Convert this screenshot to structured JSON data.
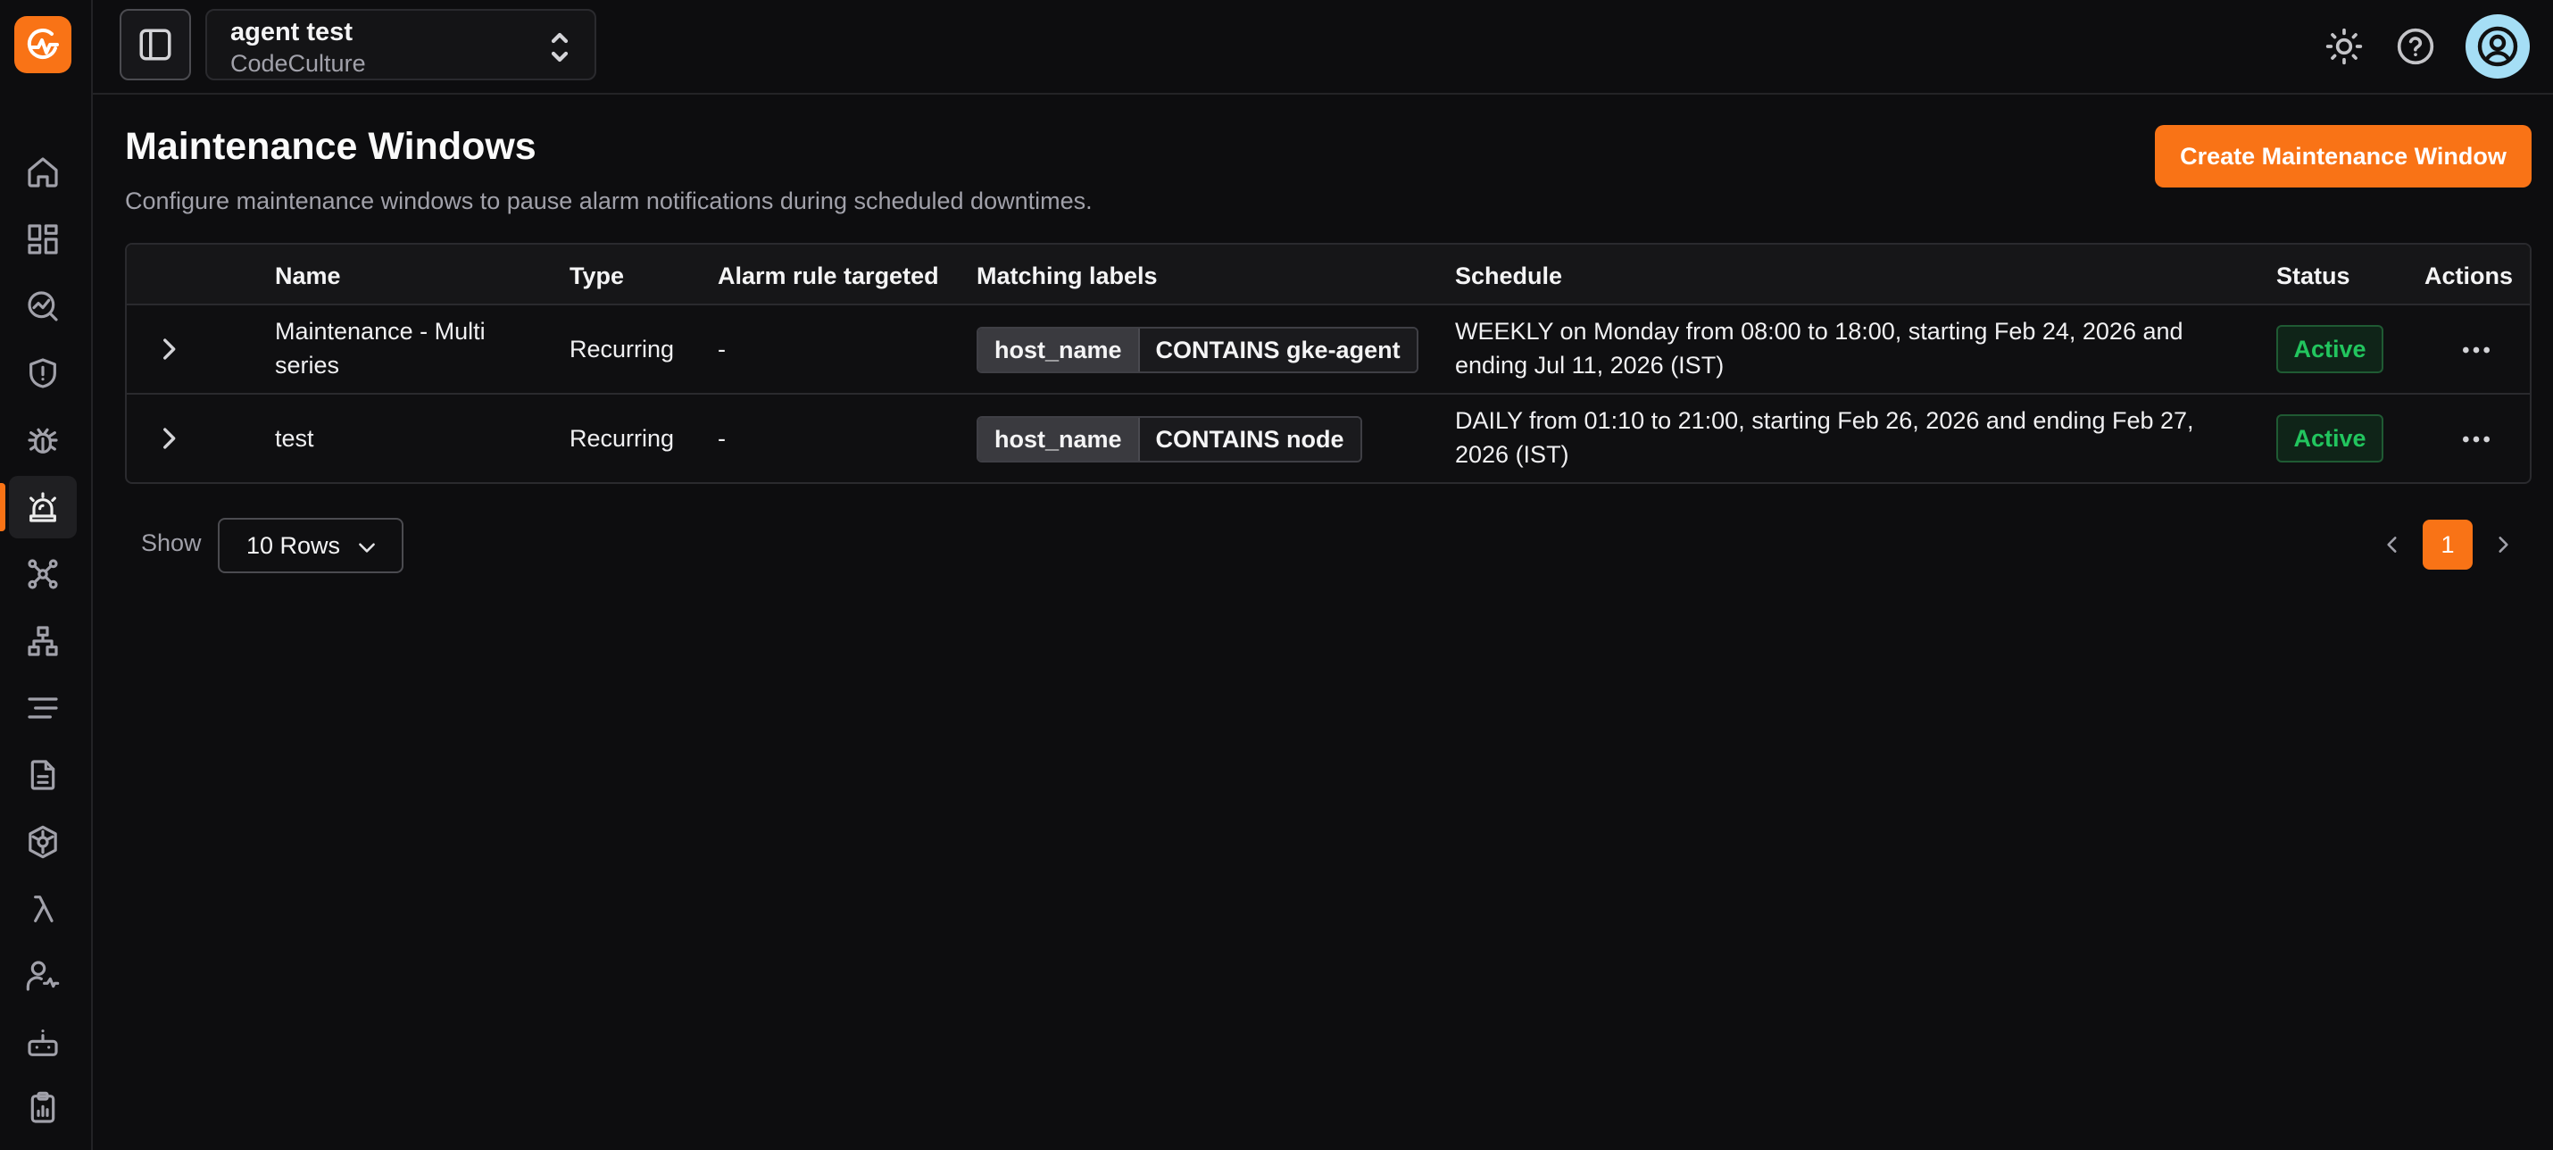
{
  "header": {
    "project_name": "agent test",
    "org_name": "CodeCulture"
  },
  "sidebar": {
    "items": [
      {
        "icon": "home-icon"
      },
      {
        "icon": "dashboard-icon"
      },
      {
        "icon": "metrics-explorer-icon"
      },
      {
        "icon": "shield-icon"
      },
      {
        "icon": "bug-icon"
      },
      {
        "icon": "alarm-icon",
        "active": true
      },
      {
        "icon": "service-map-icon"
      },
      {
        "icon": "hierarchy-icon"
      },
      {
        "icon": "logs-icon"
      },
      {
        "icon": "document-icon"
      },
      {
        "icon": "kubernetes-icon"
      },
      {
        "icon": "lambda-icon"
      },
      {
        "icon": "user-monitor-icon"
      },
      {
        "icon": "robot-icon"
      },
      {
        "icon": "reports-icon"
      }
    ]
  },
  "page": {
    "title": "Maintenance Windows",
    "subtitle": "Configure maintenance windows to pause alarm notifications during scheduled downtimes.",
    "create_button": "Create Maintenance Window"
  },
  "table": {
    "columns": [
      "Name",
      "Type",
      "Alarm rule targeted",
      "Matching labels",
      "Schedule",
      "Status",
      "Actions"
    ],
    "rows": [
      {
        "name_line1": "Maintenance - Multi",
        "name_line2": "series",
        "type": "Recurring",
        "alarm_rule": "-",
        "label_key": "host_name",
        "label_value": "CONTAINS gke-agent",
        "schedule_line1": "WEEKLY on Monday from 08:00 to 18:00, starting Feb 24, 2026 and",
        "schedule_line2": "ending Jul 11, 2026 (IST)",
        "status": "Active"
      },
      {
        "name_line1": "test",
        "name_line2": "",
        "type": "Recurring",
        "alarm_rule": "-",
        "label_key": "host_name",
        "label_value": "CONTAINS node",
        "schedule_line1": "DAILY from 01:10 to 21:00, starting Feb 26, 2026 and ending Feb 27,",
        "schedule_line2": "2026 (IST)",
        "status": "Active"
      }
    ]
  },
  "footer": {
    "show_label": "Show",
    "rows_select": "10 Rows",
    "current_page": "1"
  },
  "colors": {
    "accent": "#f97316",
    "background": "#0d0d0f",
    "status_active": "#22c55e"
  }
}
